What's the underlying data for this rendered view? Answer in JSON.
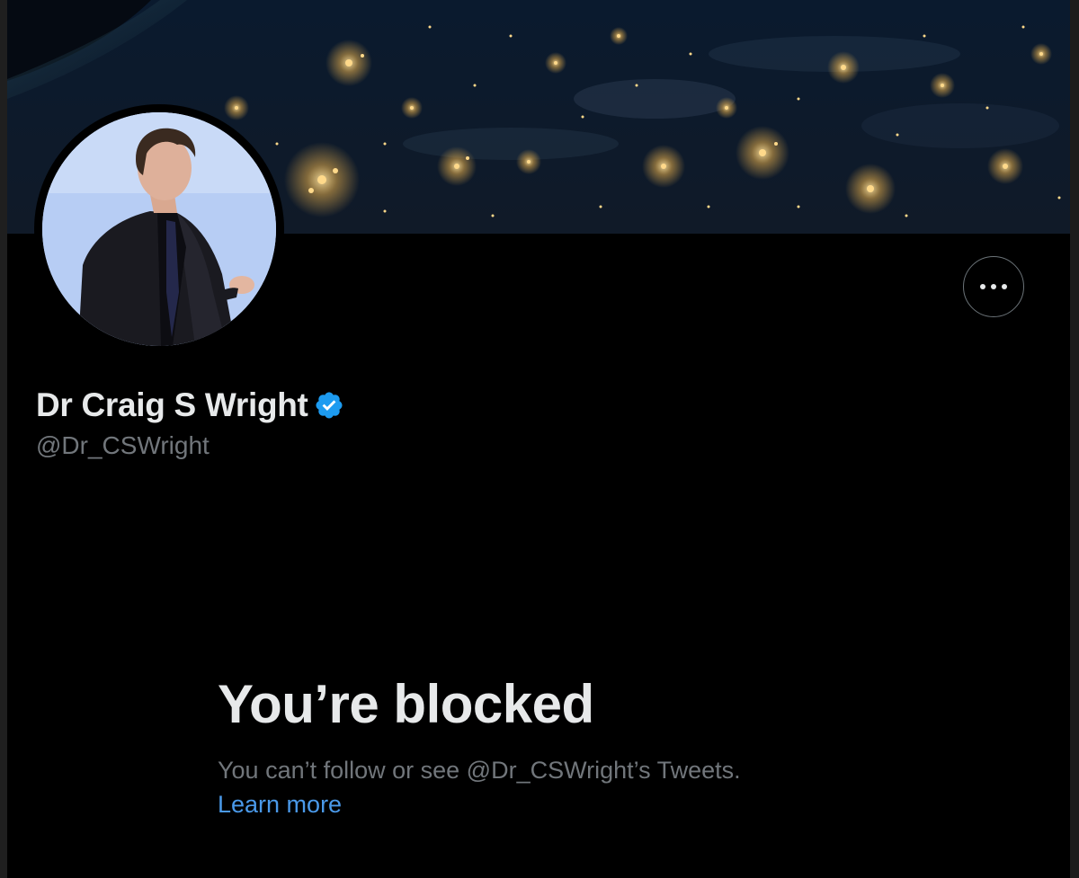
{
  "profile": {
    "display_name": "Dr Craig S Wright",
    "handle": "@Dr_CSWright",
    "verified": true
  },
  "actions": {
    "more_label": "More"
  },
  "blocked": {
    "title": "You’re blocked",
    "description": "You can’t follow or see @Dr_CSWright’s Tweets.",
    "learn_more": "Learn more"
  },
  "icons": {
    "verified": "verified-badge-icon",
    "more": "more-options-icon"
  },
  "colors": {
    "background": "#000000",
    "text_primary": "#e7e9ea",
    "text_secondary": "#71767b",
    "link": "#4a99e9",
    "verified_badge": "#1d9bf0"
  }
}
